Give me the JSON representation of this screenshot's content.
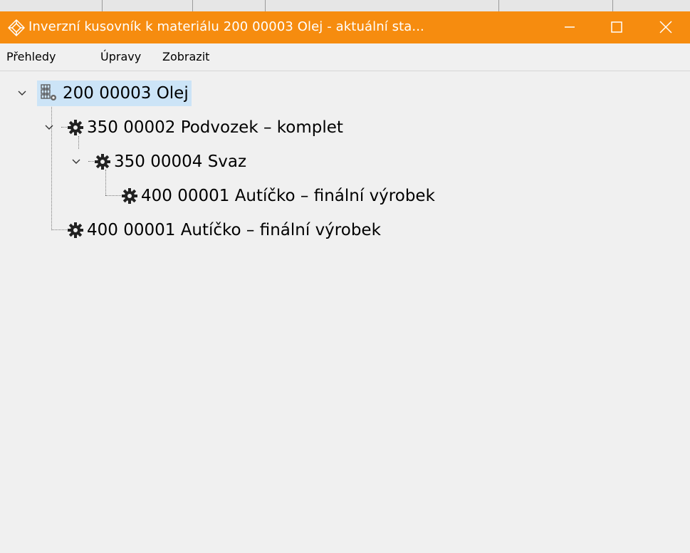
{
  "window": {
    "title": "Inverzní kusovník k materiálu 200 00003 Olej - aktuální sta...",
    "accent_color": "#f68c0f",
    "icons": [
      "app-icon",
      "minimize-icon",
      "maximize-icon",
      "close-icon"
    ]
  },
  "menu": {
    "items": [
      {
        "label": "Přehledy"
      },
      {
        "label": "Úpravy"
      },
      {
        "label": "Zobrazit"
      }
    ]
  },
  "tree": {
    "root": {
      "label": "200 00003 Olej",
      "icon": "material-stack-icon",
      "expanded": true,
      "selected": true
    },
    "nodes": [
      {
        "label": "350 00002 Podvozek – komplet",
        "icon": "gear-icon",
        "level": 1,
        "expanded": true
      },
      {
        "label": "350 00004 Svaz",
        "icon": "gear-icon",
        "level": 2,
        "expanded": true
      },
      {
        "label": "400 00001 Autíčko – finální výrobek",
        "icon": "gear-icon",
        "level": 3
      },
      {
        "label": "400 00001 Autíčko – finální výrobek",
        "icon": "gear-icon",
        "level": 1
      }
    ]
  }
}
